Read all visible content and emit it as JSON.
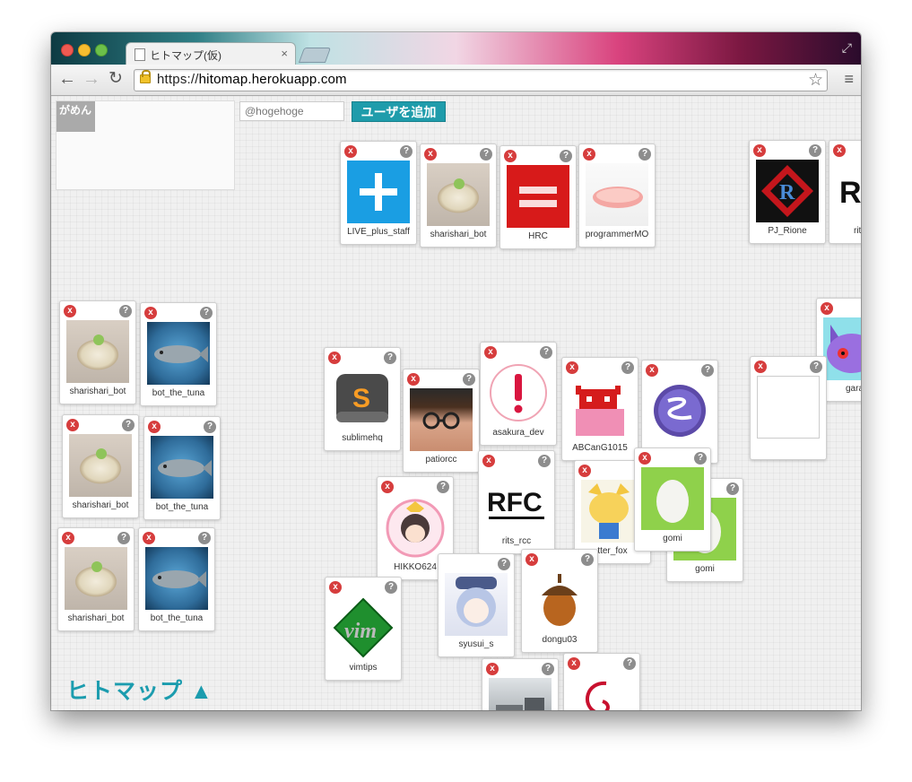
{
  "browser": {
    "tab_title": "ヒトマップ(仮)",
    "tab_close": "×",
    "url_scheme": "https://",
    "url_host": "hitomap.herokuapp.com"
  },
  "icons": {
    "back": "←",
    "forward": "→",
    "reload": "↻",
    "star": "☆",
    "menu": "≡",
    "remove": "x",
    "help": "?"
  },
  "app": {
    "panel_label": "がめん",
    "input_placeholder": "@hogehoge",
    "add_button": "ユーザを追加",
    "logo": "ヒトマップ ▲"
  },
  "cards": [
    {
      "name": "LIVE_plus_staff"
    },
    {
      "name": "sharishari_bot"
    },
    {
      "name": "HRC"
    },
    {
      "name": "programmerMO"
    },
    {
      "name": "PJ_Rione"
    },
    {
      "name": "rit"
    },
    {
      "name": "sharishari_bot"
    },
    {
      "name": "bot_the_tuna"
    },
    {
      "name": "sharishari_bot"
    },
    {
      "name": "bot_the_tuna"
    },
    {
      "name": "sharishari_bot"
    },
    {
      "name": "bot_the_tuna"
    },
    {
      "name": "gara"
    },
    {
      "name": "sublimehq"
    },
    {
      "name": "patiorcc"
    },
    {
      "name": "asakura_dev"
    },
    {
      "name": "ABCanG1015"
    },
    {
      "name": ""
    },
    {
      "name": ""
    },
    {
      "name": "rits_rcc"
    },
    {
      "name": "tter_fox"
    },
    {
      "name": "gomi"
    },
    {
      "name": "gomi"
    },
    {
      "name": "HIKKO624"
    },
    {
      "name": "vimtips"
    },
    {
      "name": "syusui_s"
    },
    {
      "name": "dongu03"
    },
    {
      "name": ""
    },
    {
      "name": ""
    }
  ],
  "colors": {
    "accent": "#1b9cae",
    "remove_badge": "#d63d3d",
    "help_badge": "#8d8d8d"
  }
}
